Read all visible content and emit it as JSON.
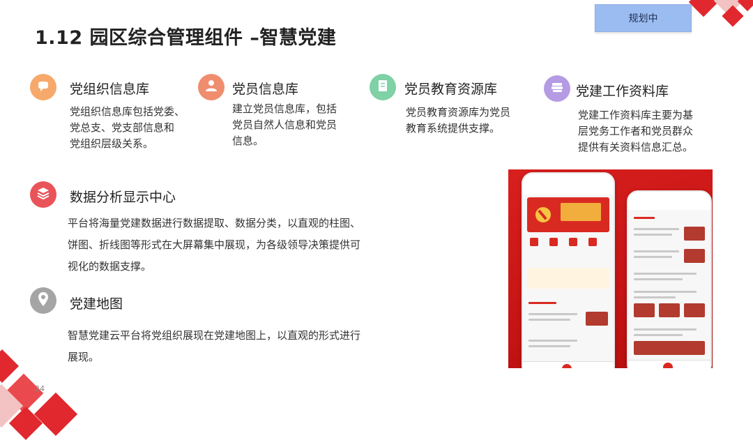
{
  "header": {
    "title": "1.12 园区综合管理组件 –智慧党建",
    "status_badge": "规划中"
  },
  "features": [
    {
      "icon": "chat-bubble-icon",
      "title": "党组织信息库",
      "desc_lines": [
        "党组织信息库包括党委、",
        "党总支、党支部信息和",
        "党组织层级关系。"
      ]
    },
    {
      "icon": "user-icon",
      "title": "党员信息库",
      "desc_lines": [
        "建立党员信息库，包括",
        "党员自然人信息和党员",
        "信息。"
      ]
    },
    {
      "icon": "document-icon",
      "title": "党员教育资源库",
      "desc_lines": [
        "党员教育资源库为党员",
        "教育系统提供支撑。"
      ]
    },
    {
      "icon": "books-icon",
      "title": "党建工作资料库",
      "desc_lines": [
        "党建工作资料库主要为基",
        "层党务工作者和党员群众",
        "提供有关资料信息汇总。"
      ]
    }
  ],
  "sections": [
    {
      "icon": "layers-icon",
      "title": "数据分析显示中心",
      "desc_lines": [
        "平台将海量党建数据进行数据提取、数据分类，以直观的柱图、",
        "饼图、折线图等形式在大屏幕集中展现，为各级领导决策提供可",
        "视化的数据支撑。"
      ]
    },
    {
      "icon": "map-pin-icon",
      "title": "党建地图",
      "desc_lines": [
        "智慧党建云平台将党组织展现在党建地图上，以直观的形式进行",
        "展现。"
      ]
    }
  ],
  "footer": {
    "page_number": "24"
  },
  "colors": {
    "orange": "#f6a96b",
    "salmon": "#ef8d6e",
    "green": "#7fd1a6",
    "purple": "#b59be3",
    "red": "#e9545a",
    "gray": "#a5a5a5",
    "brand_red": "#e0282e",
    "badge_blue": "#9bbcf0"
  }
}
